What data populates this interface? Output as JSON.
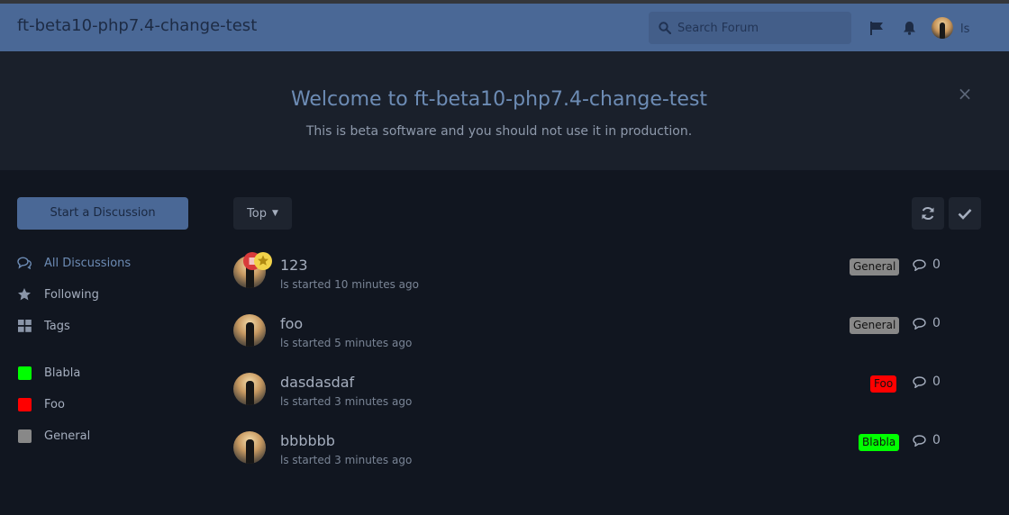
{
  "header": {
    "site_title": "ft-beta10-php7.4-change-test",
    "search_placeholder": "Search Forum",
    "user_name": "ls"
  },
  "hero": {
    "title": "Welcome to ft-beta10-php7.4-change-test",
    "subtitle": "This is beta software and you should not use it in production.",
    "close": "×"
  },
  "sidebar": {
    "start_button": "Start a Discussion",
    "nav": [
      {
        "label": "All Discussions",
        "icon": "comments-icon",
        "active": true
      },
      {
        "label": "Following",
        "icon": "star-icon"
      },
      {
        "label": "Tags",
        "icon": "grid-icon"
      }
    ],
    "tags": [
      {
        "label": "Blabla",
        "color": "#00ff00"
      },
      {
        "label": "Foo",
        "color": "#ff0000"
      },
      {
        "label": "General",
        "color": "#888888"
      }
    ]
  },
  "toolbar": {
    "sort_label": "Top"
  },
  "discussions": [
    {
      "title": "123",
      "meta": "ls started 10 minutes ago",
      "tag": "General",
      "tag_color": "#888888",
      "replies": "0",
      "badges": [
        "sticky-badge",
        "featured-badge"
      ]
    },
    {
      "title": "foo",
      "meta": "ls started 5 minutes ago",
      "tag": "General",
      "tag_color": "#888888",
      "replies": "0"
    },
    {
      "title": "dasdasdaf",
      "meta": "ls started 3 minutes ago",
      "tag": "Foo",
      "tag_color": "#ff0000",
      "replies": "0"
    },
    {
      "title": "bbbbbb",
      "meta": "ls started 3 minutes ago",
      "tag": "Blabla",
      "tag_color": "#00ff00",
      "replies": "0"
    }
  ],
  "colors": {
    "header_bg": "#4a6896",
    "page_bg": "#111620",
    "hero_bg": "#1a202b",
    "accent": "#6d8cb5"
  }
}
